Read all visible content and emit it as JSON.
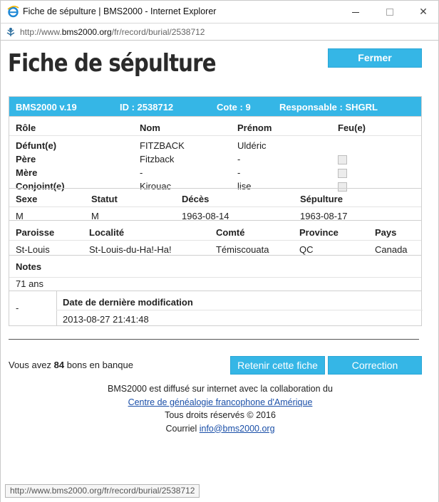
{
  "window": {
    "title": "Fiche de sépulture | BMS2000 - Internet Explorer",
    "url_prefix": "http://www.",
    "url_domain": "bms2000.org",
    "url_path": "/fr/record/burial/2538712"
  },
  "page": {
    "title": "Fiche de sépulture",
    "close_label": "Fermer"
  },
  "record_header": {
    "version": "BMS2000 v.19",
    "id": "ID : 2538712",
    "cote": "Cote : 9",
    "responsable": "Responsable : SHGRL"
  },
  "persons": {
    "headers": [
      "Rôle",
      "Nom",
      "Prénom",
      "Feu(e)"
    ],
    "rows": [
      {
        "role": "Défunt(e)",
        "nom": "FITZBACK",
        "prenom": "Uldéric",
        "feu": null
      },
      {
        "role": "Père",
        "nom": "Fitzback",
        "prenom": "-",
        "feu": false
      },
      {
        "role": "Mère",
        "nom": "-",
        "prenom": "-",
        "feu": false
      },
      {
        "role": "Conjoint(e)",
        "nom": "Kirouac",
        "prenom": "lise",
        "feu": false
      }
    ]
  },
  "status": {
    "headers": [
      "Sexe",
      "Statut",
      "Décès",
      "Sépulture"
    ],
    "values": [
      "M",
      "M",
      "1963-08-14",
      "1963-08-17"
    ]
  },
  "place": {
    "headers": [
      "Paroisse",
      "Localité",
      "Comté",
      "Province",
      "Pays"
    ],
    "values": [
      "St-Louis",
      "St-Louis-du-Ha!-Ha!",
      "Témiscouata",
      "QC",
      "Canada"
    ]
  },
  "notes": {
    "header": "Notes",
    "value": "71 ans"
  },
  "modification": {
    "left": "-",
    "header": "Date de dernière modification",
    "value": "2013-08-27 21:41:48"
  },
  "bank": {
    "prefix": "Vous avez",
    "count": "84",
    "suffix": "bons en banque"
  },
  "actions": {
    "retain_label": "Retenir cette fiche",
    "correction_label": "Correction"
  },
  "footer": {
    "line1": "BMS2000 est diffusé sur internet avec la collaboration du",
    "link1": "Centre de généalogie francophone d'Amérique",
    "line3": "Tous droits réservés © 2016",
    "courriel_label": "Courriel",
    "email": "info@bms2000.org"
  },
  "statusbar": {
    "text": "http://www.bms2000.org/fr/record/burial/2538712"
  },
  "colors": {
    "accent": "#35b6e6",
    "link": "#1a4fa8"
  },
  "icons": {
    "browser": "ie-icon",
    "address": "globe-icon"
  }
}
